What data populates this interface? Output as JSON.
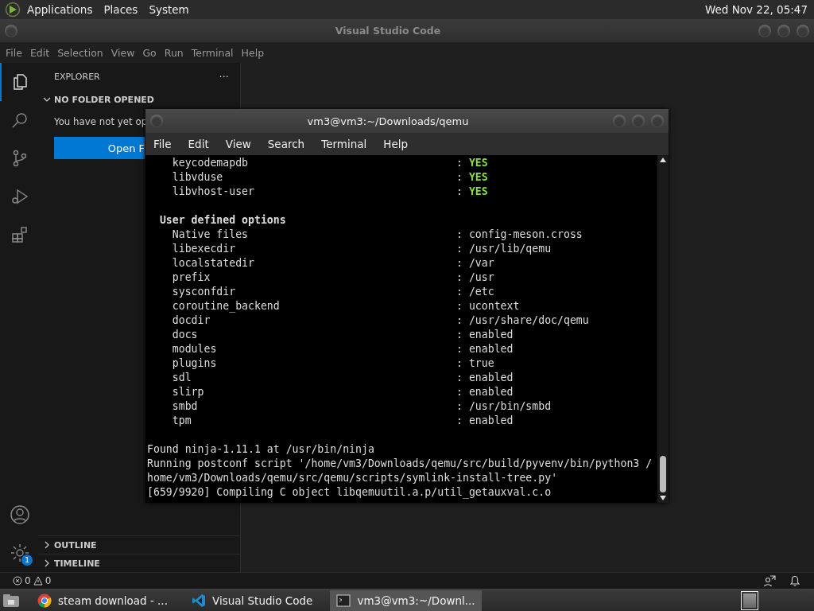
{
  "top_panel": {
    "menus": [
      "Applications",
      "Places",
      "System"
    ],
    "clock": "Wed Nov 22, 05:47"
  },
  "vscode": {
    "title": "Visual Studio Code",
    "menu": [
      "File",
      "Edit",
      "Selection",
      "View",
      "Go",
      "Run",
      "Terminal",
      "Help"
    ],
    "activity_bar": [
      {
        "kind": "explorer",
        "selected": true
      },
      {
        "kind": "search",
        "selected": false
      },
      {
        "kind": "source-control",
        "selected": false
      },
      {
        "kind": "run-debug",
        "selected": false
      },
      {
        "kind": "extensions",
        "selected": false
      }
    ],
    "settings_badge": "1",
    "explorer": {
      "title": "EXPLORER",
      "more": "···",
      "section": "NO FOLDER OPENED",
      "message": "You have not yet op",
      "button": "Open F",
      "bottom_sections": [
        "OUTLINE",
        "TIMELINE"
      ]
    },
    "status_bar": {
      "errors": "0",
      "warnings": "0"
    }
  },
  "terminal": {
    "title": "vm3@vm3:~/Downloads/qemu",
    "menu": [
      "File",
      "Edit",
      "View",
      "Search",
      "Terminal",
      "Help"
    ],
    "separator": ":",
    "lines": [
      {
        "kind": "option",
        "name": "keycodemapdb",
        "value": "YES",
        "highlighted": true
      },
      {
        "kind": "option",
        "name": "libvduse",
        "value": "YES",
        "highlighted": true
      },
      {
        "kind": "option",
        "name": "libvhost-user",
        "value": "YES",
        "highlighted": true
      },
      {
        "kind": "blank"
      },
      {
        "kind": "heading",
        "text": "User defined options"
      },
      {
        "kind": "option",
        "name": "Native files",
        "value": "config-meson.cross",
        "highlighted": false
      },
      {
        "kind": "option",
        "name": "libexecdir",
        "value": "/usr/lib/qemu",
        "highlighted": false
      },
      {
        "kind": "option",
        "name": "localstatedir",
        "value": "/var",
        "highlighted": false
      },
      {
        "kind": "option",
        "name": "prefix",
        "value": "/usr",
        "highlighted": false
      },
      {
        "kind": "option",
        "name": "sysconfdir",
        "value": "/etc",
        "highlighted": false
      },
      {
        "kind": "option",
        "name": "coroutine_backend",
        "value": "ucontext",
        "highlighted": false
      },
      {
        "kind": "option",
        "name": "docdir",
        "value": "/usr/share/doc/qemu",
        "highlighted": false
      },
      {
        "kind": "option",
        "name": "docs",
        "value": "enabled",
        "highlighted": false
      },
      {
        "kind": "option",
        "name": "modules",
        "value": "enabled",
        "highlighted": false
      },
      {
        "kind": "option",
        "name": "plugins",
        "value": "true",
        "highlighted": false
      },
      {
        "kind": "option",
        "name": "sdl",
        "value": "enabled",
        "highlighted": false
      },
      {
        "kind": "option",
        "name": "slirp",
        "value": "enabled",
        "highlighted": false
      },
      {
        "kind": "option",
        "name": "smbd",
        "value": "/usr/bin/smbd",
        "highlighted": false
      },
      {
        "kind": "option",
        "name": "tpm",
        "value": "enabled",
        "highlighted": false
      },
      {
        "kind": "blank"
      },
      {
        "kind": "text",
        "text": "Found ninja-1.11.1 at /usr/bin/ninja"
      },
      {
        "kind": "text",
        "text": "Running postconf script '/home/vm3/Downloads/qemu/src/build/pyvenv/bin/python3 /"
      },
      {
        "kind": "text",
        "text": "home/vm3/Downloads/qemu/src/qemu/scripts/symlink-install-tree.py'"
      },
      {
        "kind": "text",
        "text": "[659/9920] Compiling C object libqemuutil.a.p/util_getauxval.c.o"
      }
    ]
  },
  "taskbar": {
    "tasks": [
      {
        "kind": "browser",
        "label": "steam download - ...",
        "selected": false
      },
      {
        "kind": "editor",
        "label": "Visual Studio Code",
        "selected": false
      },
      {
        "kind": "terminal",
        "label": "vm3@vm3:~/Downl...",
        "selected": true
      }
    ]
  }
}
